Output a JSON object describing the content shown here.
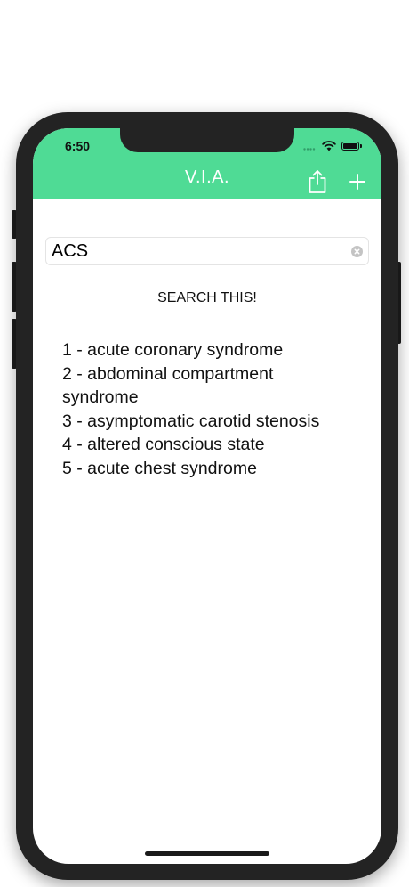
{
  "status_bar": {
    "time": "6:50"
  },
  "nav": {
    "title": "V.I.A.",
    "share_icon": "share-icon",
    "add_icon": "plus-icon"
  },
  "search": {
    "value": "ACS",
    "clear_icon": "clear-icon"
  },
  "search_button": {
    "label": "SEARCH THIS!"
  },
  "results": [
    "1 - acute coronary syndrome",
    "2 - abdominal compartment syndrome",
    "3 - asymptomatic carotid stenosis",
    "4 - altered conscious state",
    "5 - acute chest syndrome"
  ],
  "colors": {
    "accent": "#4fdb95",
    "nav_text": "#ffffff",
    "device_frame": "#232323"
  }
}
